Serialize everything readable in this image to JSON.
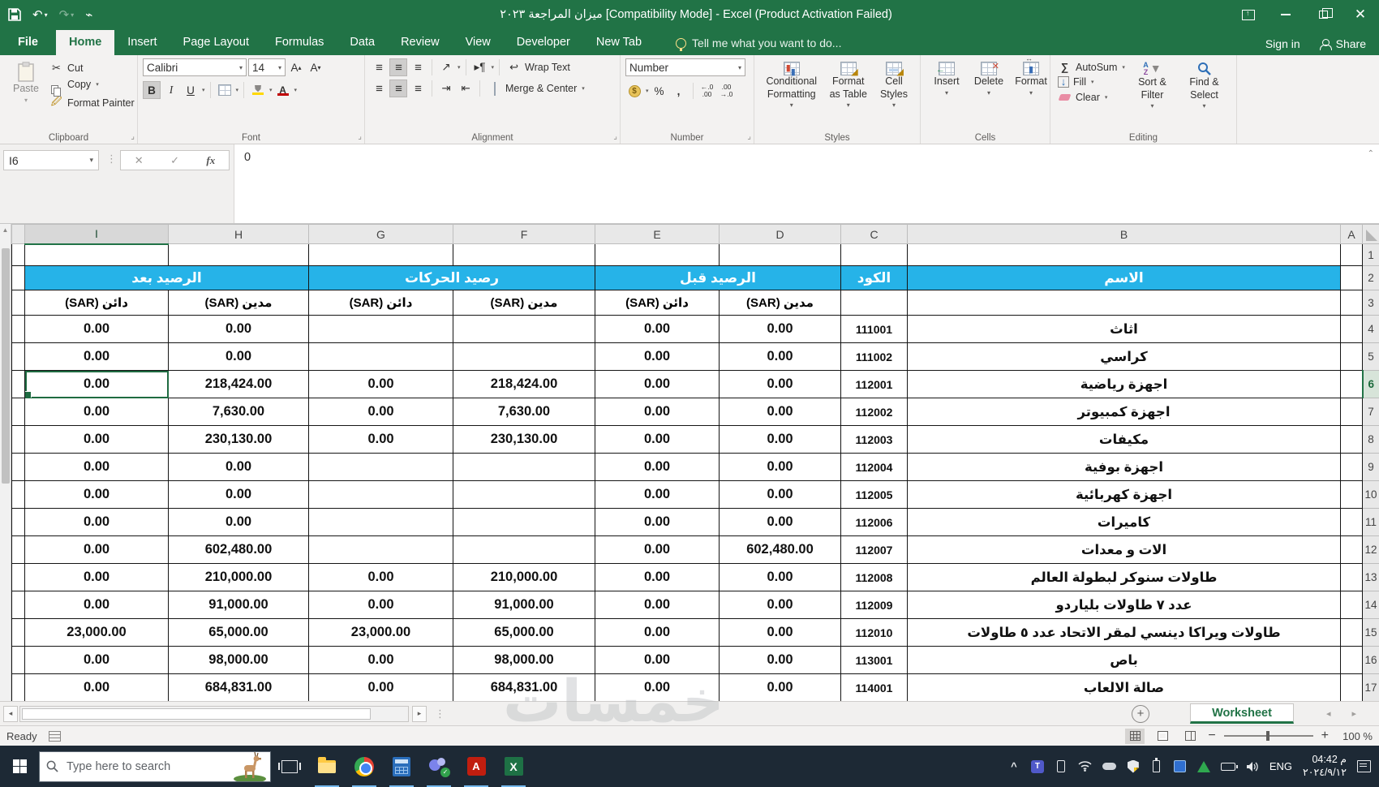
{
  "titlebar": {
    "doc_title_ar": "ميزان المراجعة ٢٠٢٣",
    "doc_title_suffix": " [Compatibility Mode] - Excel (Product Activation Failed)"
  },
  "tabs": [
    "File",
    "Home",
    "Insert",
    "Page Layout",
    "Formulas",
    "Data",
    "Review",
    "View",
    "Developer",
    "New Tab"
  ],
  "active_tab": "Home",
  "tellme": "Tell me what you want to do...",
  "account": {
    "signin": "Sign in",
    "share": "Share"
  },
  "ribbon": {
    "clipboard": {
      "label": "Clipboard",
      "paste": "Paste",
      "cut": "Cut",
      "copy": "Copy",
      "format_painter": "Format Painter"
    },
    "font": {
      "label": "Font",
      "name": "Calibri",
      "size": "14"
    },
    "alignment": {
      "label": "Alignment",
      "wrap": "Wrap Text",
      "merge": "Merge & Center"
    },
    "number": {
      "label": "Number",
      "format": "Number"
    },
    "styles": {
      "label": "Styles",
      "conditional": "Conditional Formatting",
      "format_table": "Format as Table",
      "cell_styles": "Cell Styles"
    },
    "cells": {
      "label": "Cells",
      "insert": "Insert",
      "delete": "Delete",
      "format": "Format"
    },
    "editing": {
      "label": "Editing",
      "autosum": "AutoSum",
      "fill": "Fill",
      "clear": "Clear",
      "sort": "Sort & Filter",
      "find": "Find & Select"
    }
  },
  "formula_bar": {
    "name_box": "I6",
    "value": "0"
  },
  "sheet": {
    "columns": [
      "I",
      "H",
      "G",
      "F",
      "E",
      "D",
      "C",
      "B",
      "A"
    ],
    "selected": {
      "col": "I",
      "row": 6
    },
    "groups": [
      {
        "label": "الرصيد بعد",
        "span": 2
      },
      {
        "label": "رصيد الحركات",
        "span": 2
      },
      {
        "label": "الرصيد قبل",
        "span": 2
      },
      {
        "label": "الكود",
        "span": 1
      },
      {
        "label": "الاسم",
        "span": 1
      }
    ],
    "subheaders": [
      "دائن (SAR)",
      "مدين (SAR)",
      "دائن (SAR)",
      "مدين (SAR)",
      "دائن (SAR)",
      "مدين (SAR)"
    ],
    "rows": [
      {
        "n": 4,
        "i": "0.00",
        "h": "0.00",
        "g": "",
        "f": "",
        "e": "0.00",
        "d": "0.00",
        "code": "111001",
        "name": "اثاث"
      },
      {
        "n": 5,
        "i": "0.00",
        "h": "0.00",
        "g": "",
        "f": "",
        "e": "0.00",
        "d": "0.00",
        "code": "111002",
        "name": "كراسي"
      },
      {
        "n": 6,
        "i": "0.00",
        "h": "218,424.00",
        "g": "0.00",
        "f": "218,424.00",
        "e": "0.00",
        "d": "0.00",
        "code": "112001",
        "name": "اجهزة رياضية"
      },
      {
        "n": 7,
        "i": "0.00",
        "h": "7,630.00",
        "g": "0.00",
        "f": "7,630.00",
        "e": "0.00",
        "d": "0.00",
        "code": "112002",
        "name": "اجهزة كمبيوتر"
      },
      {
        "n": 8,
        "i": "0.00",
        "h": "230,130.00",
        "g": "0.00",
        "f": "230,130.00",
        "e": "0.00",
        "d": "0.00",
        "code": "112003",
        "name": "مكيفات"
      },
      {
        "n": 9,
        "i": "0.00",
        "h": "0.00",
        "g": "",
        "f": "",
        "e": "0.00",
        "d": "0.00",
        "code": "112004",
        "name": "اجهزة بوفية"
      },
      {
        "n": 10,
        "i": "0.00",
        "h": "0.00",
        "g": "",
        "f": "",
        "e": "0.00",
        "d": "0.00",
        "code": "112005",
        "name": "اجهزة كهربائية"
      },
      {
        "n": 11,
        "i": "0.00",
        "h": "0.00",
        "g": "",
        "f": "",
        "e": "0.00",
        "d": "0.00",
        "code": "112006",
        "name": "كاميرات"
      },
      {
        "n": 12,
        "i": "0.00",
        "h": "602,480.00",
        "g": "",
        "f": "",
        "e": "0.00",
        "d": "602,480.00",
        "code": "112007",
        "name": "الات و معدات"
      },
      {
        "n": 13,
        "i": "0.00",
        "h": "210,000.00",
        "g": "0.00",
        "f": "210,000.00",
        "e": "0.00",
        "d": "0.00",
        "code": "112008",
        "name": "طاولات سنوكر لبطولة العالم"
      },
      {
        "n": 14,
        "i": "0.00",
        "h": "91,000.00",
        "g": "0.00",
        "f": "91,000.00",
        "e": "0.00",
        "d": "0.00",
        "code": "112009",
        "name": "عدد ٧ طاولات بلياردو"
      },
      {
        "n": 15,
        "i": "23,000.00",
        "h": "65,000.00",
        "g": "23,000.00",
        "f": "65,000.00",
        "e": "0.00",
        "d": "0.00",
        "code": "112010",
        "name": "طاولات  ويراكا دينسي لمقر الاتحاد عدد ٥ طاولات"
      },
      {
        "n": 16,
        "i": "0.00",
        "h": "98,000.00",
        "g": "0.00",
        "f": "98,000.00",
        "e": "0.00",
        "d": "0.00",
        "code": "113001",
        "name": "باص"
      },
      {
        "n": 17,
        "i": "0.00",
        "h": "684,831.00",
        "g": "0.00",
        "f": "684,831.00",
        "e": "0.00",
        "d": "0.00",
        "code": "114001",
        "name": "صالة الالعاب"
      }
    ]
  },
  "sheet_tabs": {
    "active": "Worksheet"
  },
  "status": {
    "ready": "Ready",
    "zoom": "100 %"
  },
  "taskbar": {
    "search_placeholder": "Type here to search",
    "lang": "ENG",
    "time": "04:42 م",
    "date": "٢٠٢٤/٩/١٢"
  },
  "watermark": "خمسات",
  "colors": {
    "excel_green": "#217346",
    "header_cyan": "#26b3e8",
    "taskbar": "#1d2935"
  }
}
